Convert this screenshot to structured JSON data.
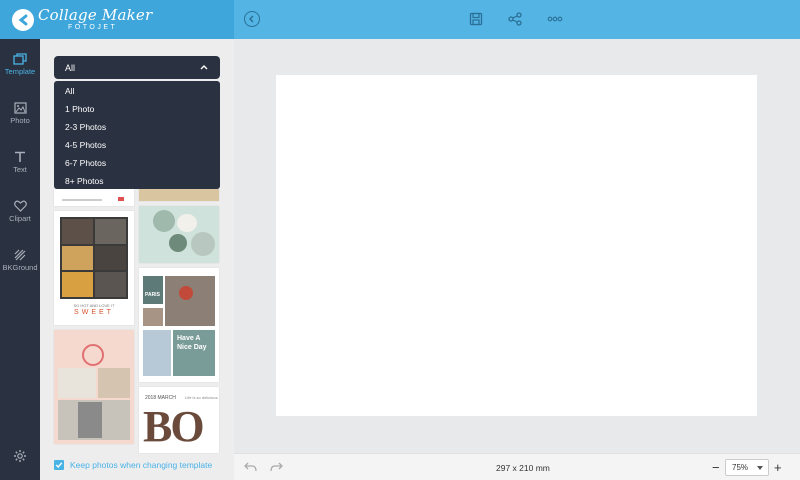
{
  "app": {
    "logo_title": "Collage Maker",
    "logo_sub": "FOTOJET"
  },
  "topbar": {
    "icons": [
      "back-icon",
      "save-icon",
      "share-icon",
      "more-icon"
    ]
  },
  "rail": {
    "items": [
      {
        "label": "Template",
        "icon": "template-icon",
        "active": true
      },
      {
        "label": "Photo",
        "icon": "photo-icon",
        "active": false
      },
      {
        "label": "Text",
        "icon": "text-icon",
        "active": false
      },
      {
        "label": "Clipart",
        "icon": "heart-icon",
        "active": false
      },
      {
        "label": "BKGround",
        "icon": "background-icon",
        "active": false
      }
    ],
    "settings_icon": "gear-icon"
  },
  "panel": {
    "filter": {
      "selected": "All",
      "options": [
        "All",
        "1 Photo",
        "2-3 Photos",
        "4-5 Photos",
        "6-7 Photos",
        "8+ Photos"
      ]
    },
    "templates": [
      {
        "text": [
          "SO HOT AND LOVE IT",
          "SWEET"
        ]
      },
      {
        "text": [
          "PARIS",
          "Have A",
          "Nice Day"
        ]
      },
      {
        "text": [
          "2018 MARCH",
          "Life is so delicious.",
          "BO"
        ]
      }
    ],
    "keep_photos_label": "Keep photos when changing template",
    "keep_photos_checked": true
  },
  "bottombar": {
    "dimensions": "297 x 210 mm",
    "zoom": "75%",
    "zoom_out_label": "−",
    "zoom_in_label": "+"
  },
  "colors": {
    "topbar": "#54b4e4",
    "logo_bg": "#3ea6da",
    "rail": "#2a3140",
    "accent": "#4ab3e6"
  }
}
